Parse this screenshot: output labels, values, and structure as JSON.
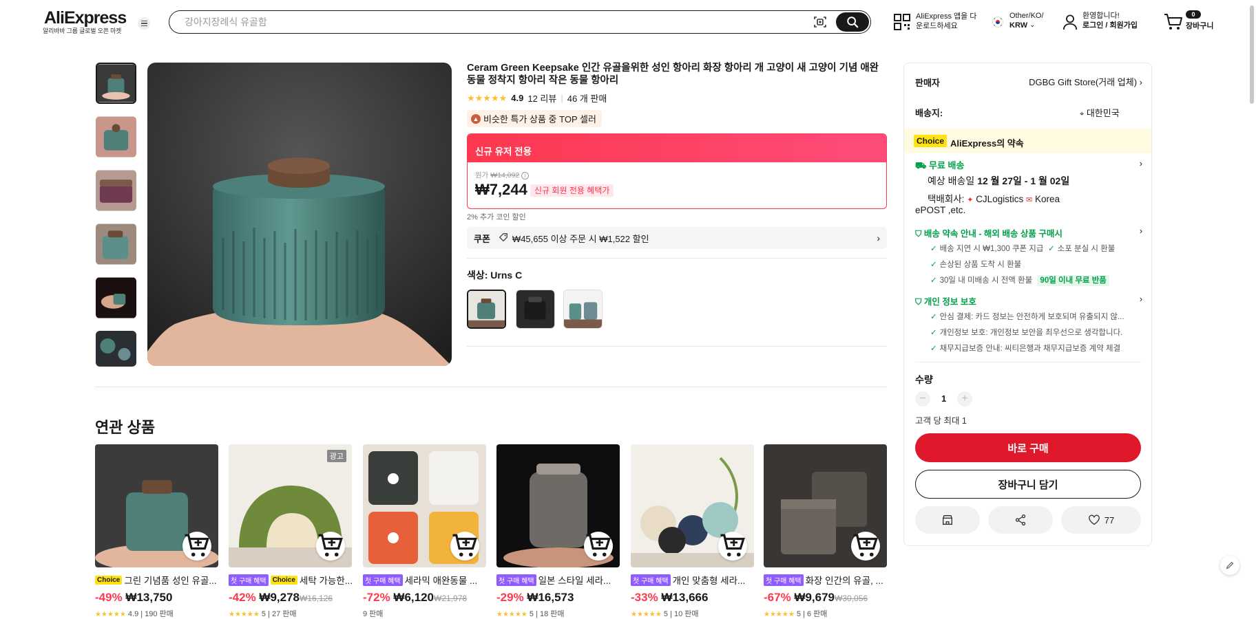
{
  "header": {
    "logo": "AliExpress",
    "logo_sub": "알리바바 그룹 글로벌 오픈 마켓",
    "search_placeholder": "강아지장례식 유골함",
    "app_promo_line1": "AliExpress 앱을 다",
    "app_promo_line2": "운로드하세요",
    "locale_line1": "Other/KO/",
    "locale_line2": "KRW",
    "account_line1": "환영합니다!",
    "account_line2": "로그인 / 회원가입",
    "cart_count": "0",
    "cart_label": "장바구니"
  },
  "product": {
    "title": "Ceram Green Keepsake 인간 유골을위한 성인 항아리 화장 항아리 개 고양이 새 고양이 기념 애완 동물 정착지 항아리 작은 동물 항아리",
    "rating": "4.9",
    "reviews": "12 리뷰",
    "sold": "46 개 판매",
    "top_badge": "비슷한 특가 상품 중 TOP 셀러",
    "promo_header": "신규 유저 전용",
    "orig_label": "원가",
    "orig_price": "₩14,092",
    "price": "₩7,244",
    "new_member_badge": "신규 회원 전용 혜택가",
    "coin_text": "2% 추가 코인 할인",
    "coupon_label": "쿠폰",
    "coupon_text": "₩45,655 이상 주문 시 ₩1,522 할인",
    "color_label": "색상: Urns C",
    "colors": {
      "accent": "#fd384f",
      "star": "#fcc02e",
      "main_teal": "#4e7f78"
    }
  },
  "related": {
    "title": "연관 상품",
    "items": [
      {
        "tag1": "Choice",
        "tag2": "",
        "name": "그린 기념품 성인 유골...",
        "discount": "-49%",
        "price": "₩13,750",
        "orig": "",
        "sub": "4.9 | 190 판매",
        "ad": ""
      },
      {
        "tag1": "첫 구매 혜택",
        "tag2": "Choice",
        "name": "세탁 가능한...",
        "discount": "-42%",
        "price": "₩9,278",
        "orig": "₩16,126",
        "sub": "5 | 27 판매",
        "ad": "광고"
      },
      {
        "tag1": "첫 구매 혜택",
        "tag2": "",
        "name": "세라믹 애완동물 ...",
        "discount": "-72%",
        "price": "₩6,120",
        "orig": "₩21,978",
        "sub": "9 판매",
        "ad": ""
      },
      {
        "tag1": "첫 구매 혜택",
        "tag2": "",
        "name": "일본 스타일 세라...",
        "discount": "-29%",
        "price": "₩16,573",
        "orig": "",
        "sub": "5 | 18 판매",
        "ad": ""
      },
      {
        "tag1": "첫 구매 혜택",
        "tag2": "",
        "name": "개인 맞춤형 세라...",
        "discount": "-33%",
        "price": "₩13,666",
        "orig": "",
        "sub": "5 | 10 판매",
        "ad": ""
      },
      {
        "tag1": "첫 구매 혜택",
        "tag2": "",
        "name": "화장 인간의 유골, ...",
        "discount": "-67%",
        "price": "₩9,679",
        "orig": "₩30,056",
        "sub": "5 | 6 판매",
        "ad": ""
      }
    ]
  },
  "sidebar": {
    "seller_label": "판매자",
    "seller_name": "DGBG Gift Store(거래 업체)",
    "ship_to_label": "배송지:",
    "ship_to_value": "대한민국",
    "choice_tag": "Choice",
    "choice_text": "AliExpress의 약속",
    "free_ship": "무료 배송",
    "delivery_prefix": "예상 배송일",
    "delivery_dates": "12 월 27일 - 1 월 02일",
    "carrier_label": "택배회사:",
    "carrier_value": "CJLogistics",
    "carrier_value2": "Korea",
    "carrier_value3": "ePOST ,etc.",
    "promise_title": "배송 약속 안내 - 해외 배송 상품 구매시",
    "promise_items": [
      "배송 지연 시 ₩1,300 쿠폰 지급",
      "소포 분실 시 환불",
      "손상된 상품 도착 시 환불",
      "30일 내 미배송 시 전액 환불"
    ],
    "return_badge": "90일 이내 무료 반품",
    "privacy_title": "개인 정보 보호",
    "privacy_items": [
      "안심 결제: 카드 정보는 안전하게 보호되며 유출되지 않...",
      "개인정보 보호: 개인정보 보안을 최우선으로 생각합니다.",
      "채무지급보증 안내: 씨티은행과 채무지급보증 계약 체결"
    ],
    "qty_label": "수량",
    "qty_value": "1",
    "qty_limit": "고객 당 최대 1",
    "buy_now": "바로 구매",
    "add_to_cart": "장바구니 담기",
    "wishlist_count": "77"
  }
}
